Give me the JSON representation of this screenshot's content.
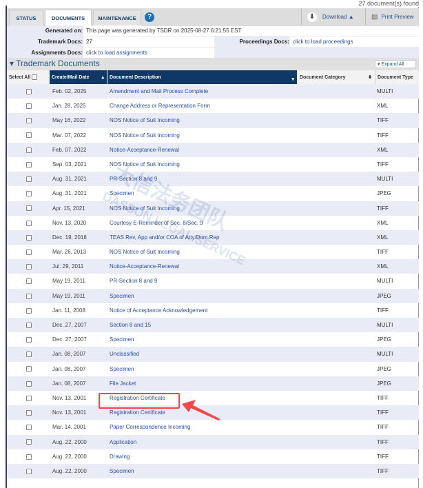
{
  "found_text": "27 document(s) found",
  "tabs": [
    "STATUS",
    "DOCUMENTS",
    "MAINTENANCE"
  ],
  "toolbar": {
    "download": "Download ▲",
    "print": "Print Preview",
    "help": "?"
  },
  "info": {
    "generated_label": "Generated on:",
    "generated_value": "This page was generated by TSDR on 2025-08-27 6:21:55 EST",
    "tm_label": "Trademark Docs:",
    "tm_value": "27",
    "proc_label": "Proceedings Docs:",
    "proc_value": "click to load proceedings",
    "assign_label": "Assignments Docs:",
    "assign_value": "click to load assignments"
  },
  "section": {
    "title": "Trademark Documents",
    "expand": "Expand All"
  },
  "columns": {
    "select": "Select All",
    "date": "Create/Mail Date",
    "desc": "Document Description",
    "category": "Document Category",
    "type": "Document Type"
  },
  "watermark": "大信法务团队 DASSON LEGAL SERVICE",
  "rows": [
    {
      "date": "Feb. 02, 2025",
      "desc": "Amendment and Mail Process Complete",
      "type": "MULTI"
    },
    {
      "date": "Jan. 28, 2025",
      "desc": "Change Address or Representation Form",
      "type": "XML"
    },
    {
      "date": "May 16, 2022",
      "desc": "NOS Notice of Suit Incoming",
      "type": "TIFF"
    },
    {
      "date": "Mar. 07, 2022",
      "desc": "NOS Notice of Suit Incoming",
      "type": "TIFF"
    },
    {
      "date": "Feb. 07, 2022",
      "desc": "Notice-Acceptance-Renewal",
      "type": "XML"
    },
    {
      "date": "Sep. 03, 2021",
      "desc": "NOS Notice of Suit Incoming",
      "type": "TIFF"
    },
    {
      "date": "Aug. 31, 2021",
      "desc": "PR-Section 8 and 9",
      "type": "MULTI"
    },
    {
      "date": "Aug. 31, 2021",
      "desc": "Specimen",
      "type": "JPEG"
    },
    {
      "date": "Apr. 15, 2021",
      "desc": "NOS Notice of Suit Incoming",
      "type": "TIFF"
    },
    {
      "date": "Nov. 13, 2020",
      "desc": "Courtesy E-Reminder of Sec. 8/Sec. 9",
      "type": "XML"
    },
    {
      "date": "Dec. 19, 2018",
      "desc": "TEAS Rev, App and/or COA of Atty/Dom.Rep",
      "type": "XML"
    },
    {
      "date": "Mar. 26, 2013",
      "desc": "NOS Notice of Suit Incoming",
      "type": "TIFF"
    },
    {
      "date": "Jul. 29, 2011",
      "desc": "Notice-Acceptance-Renewal",
      "type": "XML"
    },
    {
      "date": "May 19, 2011",
      "desc": "PR-Section 8 and 9",
      "type": "MULTI"
    },
    {
      "date": "May 19, 2011",
      "desc": "Specimen",
      "type": "JPEG"
    },
    {
      "date": "Jan. 11, 2008",
      "desc": "Notice of Acceptance Acknowledgement",
      "type": "TIFF"
    },
    {
      "date": "Dec. 27, 2007",
      "desc": "Section 8 and 15",
      "type": "MULTI"
    },
    {
      "date": "Dec. 27, 2007",
      "desc": "Specimen",
      "type": "JPEG"
    },
    {
      "date": "Jan. 08, 2007",
      "desc": "Unclassified",
      "type": "MULTI"
    },
    {
      "date": "Jan. 08, 2007",
      "desc": "Specimen",
      "type": "JPEG"
    },
    {
      "date": "Jan. 08, 2007",
      "desc": "File Jacket",
      "type": "JPEG"
    },
    {
      "date": "Nov. 13, 2001",
      "desc": "Registration Certificate",
      "type": "TIFF"
    },
    {
      "date": "Nov. 13, 2001",
      "desc": "Registration Certificate",
      "type": "TIFF"
    },
    {
      "date": "Mar. 14, 2001",
      "desc": "Paper Correspondence Incoming",
      "type": "TIFF"
    },
    {
      "date": "Aug. 22, 2000",
      "desc": "Application",
      "type": "TIFF"
    },
    {
      "date": "Aug. 22, 2000",
      "desc": "Drawing",
      "type": "TIFF"
    },
    {
      "date": "Aug. 22, 2000",
      "desc": "Specimen",
      "type": "TIFF"
    }
  ],
  "colors": {
    "header_dark": "#0f3866",
    "link": "#2a4fa6",
    "row_alt": "#e9ebf6",
    "highlight": "#f04848"
  }
}
